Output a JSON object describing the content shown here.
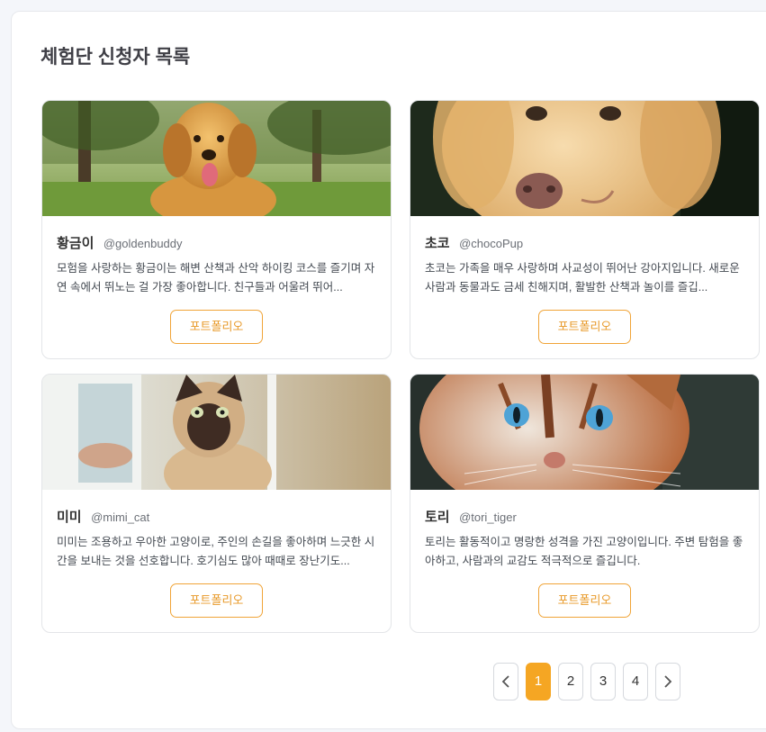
{
  "page": {
    "title": "체험단 신청자 목록"
  },
  "applicants": [
    {
      "name": "황금이",
      "handle": "@goldenbuddy",
      "description": "모험을 사랑하는 황금이는 해변 산책과 산악 하이킹 코스를 즐기며 자연 속에서 뛰노는 걸 가장 좋아합니다. 친구들과 어울려 뛰어...",
      "button_label": "포트폴리오",
      "photo": "golden-retriever-in-park"
    },
    {
      "name": "초코",
      "handle": "@chocoPup",
      "description": "초코는 가족을 매우 사랑하며 사교성이 뛰어난 강아지입니다. 새로운 사람과 동물과도 금세 친해지며, 활발한 산책과 놀이를 즐깁...",
      "button_label": "포트폴리오",
      "photo": "golden-dog-closeup"
    },
    {
      "name": "미미",
      "handle": "@mimi_cat",
      "description": "미미는 조용하고 우아한 고양이로, 주인의 손길을 좋아하며 느긋한 시간을 보내는 것을 선호합니다. 호기심도 많아 때때로 장난기도...",
      "button_label": "포트폴리오",
      "photo": "siamese-cat-by-window"
    },
    {
      "name": "토리",
      "handle": "@tori_tiger",
      "description": "토리는 활동적이고 명랑한 성격을 가진 고양이입니다. 주변 탐험을 좋아하고, 사람과의 교감도 적극적으로 즐깁니다.",
      "button_label": "포트폴리오",
      "photo": "tabby-cat-closeup"
    }
  ],
  "pagination": {
    "pages": [
      "1",
      "2",
      "3",
      "4"
    ],
    "current": "1",
    "prev_icon": "chevron-left-icon",
    "next_icon": "chevron-right-icon"
  },
  "colors": {
    "accent": "#f5a623",
    "accent_text": "#e89a2a",
    "title": "#3f3f46"
  }
}
